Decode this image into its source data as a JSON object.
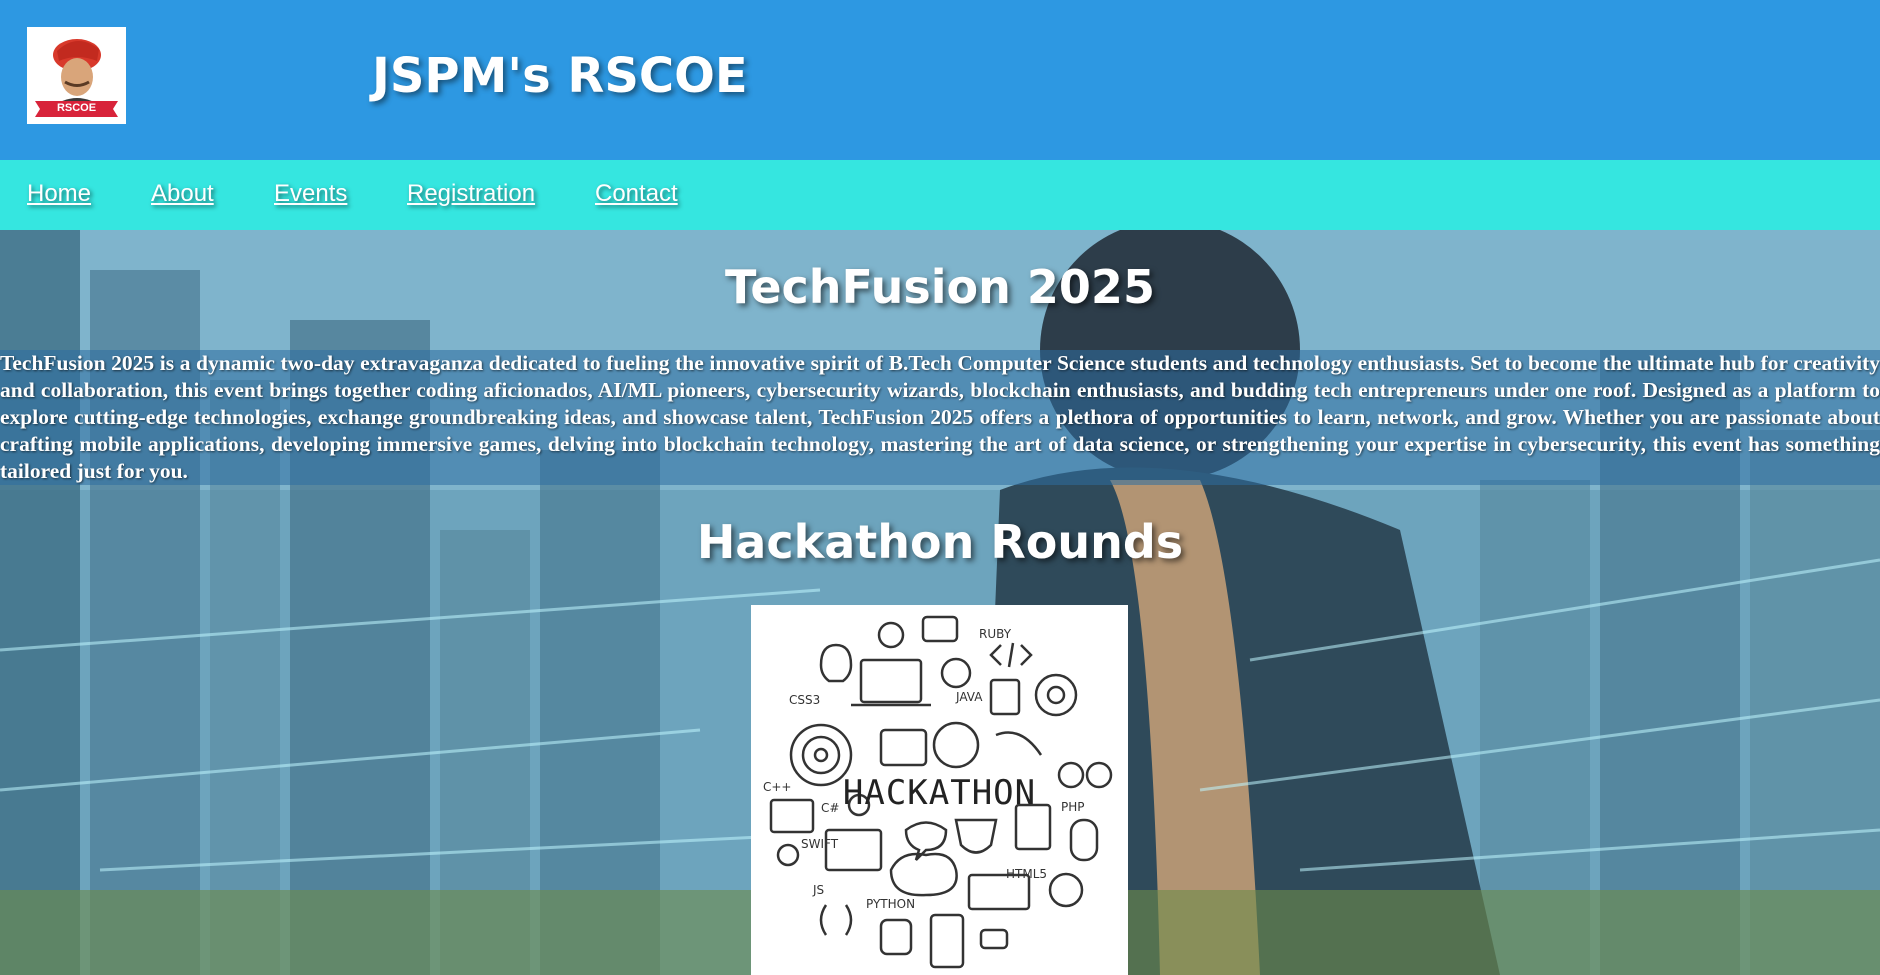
{
  "header": {
    "logo_text": "RSCOE",
    "title": "JSPM's RSCOE"
  },
  "nav": {
    "items": [
      {
        "label": "Home"
      },
      {
        "label": "About"
      },
      {
        "label": "Events"
      },
      {
        "label": "Registration"
      },
      {
        "label": "Contact"
      }
    ]
  },
  "hero": {
    "title": "TechFusion 2025",
    "description": "TechFusion 2025 is a dynamic two-day extravaganza dedicated to fueling the innovative spirit of B.Tech Computer Science students and technology enthusiasts. Set to become the ultimate hub for creativity and collaboration, this event brings together coding aficionados, AI/ML pioneers, cybersecurity wizards, blockchain enthusiasts, and budding tech entrepreneurs under one roof. Designed as a platform to explore cutting-edge technologies, exchange groundbreaking ideas, and showcase talent, TechFusion 2025 offers a plethora of opportunities to learn, network, and grow. Whether you are passionate about crafting mobile applications, developing immersive games, delving into blockchain technology, mastering the art of data science, or strengthening your expertise in cybersecurity, this event has something tailored just for you."
  },
  "rounds": {
    "title": "Hackathon Rounds",
    "image_word": "HACKATHON",
    "image_labels": [
      "CSS3",
      "JAVA",
      "RUBY",
      "C++",
      "C#",
      "PHP",
      "SWIFT",
      "JS",
      "PYTHON",
      "HTML5"
    ]
  },
  "colors": {
    "header_bg": "#2d98e2",
    "nav_bg": "#35e6e0",
    "text": "#ffffff"
  }
}
